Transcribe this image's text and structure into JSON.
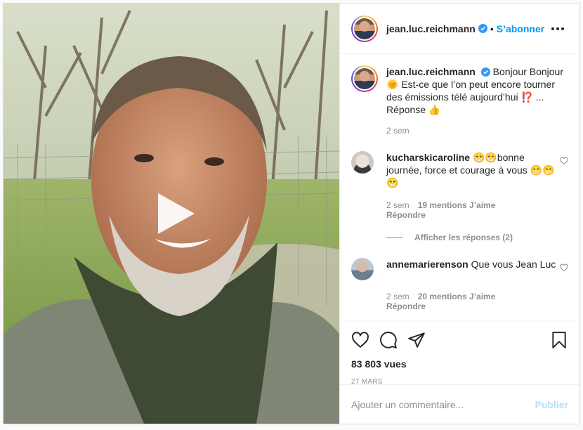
{
  "post": {
    "username": "jean.luc.reichmann",
    "follow_label": "S’abonner",
    "separator": "•",
    "caption": "Bonjour Bonjour 🌞 Est-ce que l’on peut encore tourner des émissions télé aujourd’hui ⁉️ ... Réponse 👍",
    "caption_time": "2 sem",
    "views": "83 803 vues",
    "date": "27 MARS"
  },
  "comments": [
    {
      "username": "kucharskicaroline",
      "text": "😁😁bonne journée, force et courage à vous 😁😁😁",
      "time": "2 sem",
      "likes": "19 mentions J’aime",
      "reply_label": "Répondre",
      "view_replies": "Afficher les réponses (2)"
    },
    {
      "username": "annemarierenson",
      "text": "Que vous Jean Luc",
      "time": "2 sem",
      "likes": "20 mentions J’aime",
      "reply_label": "Répondre"
    }
  ],
  "composer": {
    "placeholder": "Ajouter un commentaire...",
    "publish_label": "Publier"
  },
  "icons": {
    "verified": "verified-badge-icon",
    "more": "more-options-icon",
    "play": "play-icon",
    "like": "heart-icon",
    "comment": "comment-icon",
    "share": "share-icon",
    "save": "bookmark-icon"
  },
  "colors": {
    "accent": "#0095f6",
    "publish_disabled": "#b2dffc",
    "muted": "#8e8e8e"
  }
}
